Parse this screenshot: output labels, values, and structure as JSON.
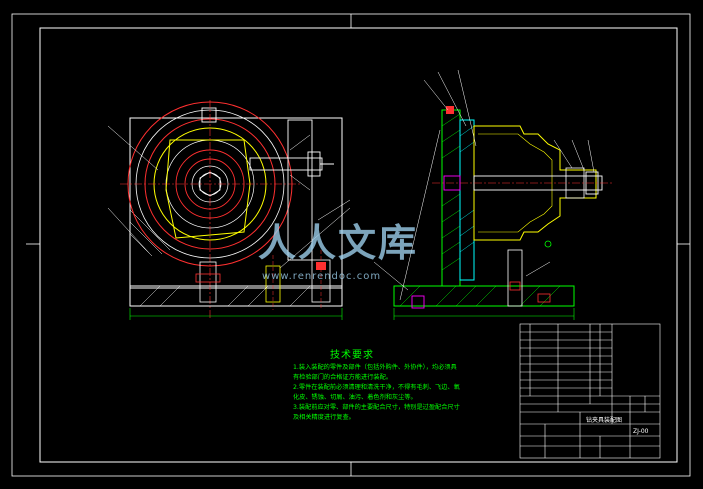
{
  "technical_requirements": {
    "title": "技术要求",
    "lines": [
      "1.装入装配的零件及部件（包括外购件、外协件），均必须具",
      "有检验部门的合格证方能进行装配。",
      "2.零件在装配前必须清理和清洗干净，不得有毛刺、飞边、氧",
      "化皮、锈蚀、切屑、油污、着色剂和灰尘等。",
      "3.装配前应对零、部件的主要配合尺寸，特别是过盈配合尺寸",
      "及相关精度进行复查。"
    ]
  },
  "watermark": {
    "text": "人人文库",
    "url": "www.renrendoc.com"
  },
  "title_block": {
    "drawing_name": "钻夹具装配图",
    "drawing_number": "ZJ-00"
  },
  "colors": {
    "background": "#000000",
    "frame": "#ffffff",
    "part_red": "#ff3030",
    "part_yellow": "#ffff00",
    "part_green": "#00ff00",
    "part_cyan": "#00ffff",
    "part_magenta": "#ff00ff"
  }
}
